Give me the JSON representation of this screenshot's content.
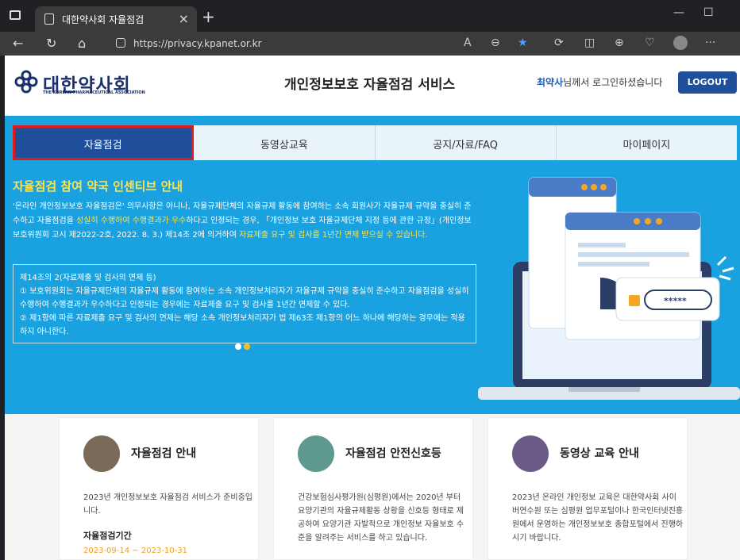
{
  "browser": {
    "tab_title": "대한약사회 자율점검",
    "url": "https://privacy.kpanet.or.kr",
    "close": "×",
    "plus": "+"
  },
  "header": {
    "logo_kr": "대한약사회",
    "logo_en": "THE KOREAN PHARMACEUTICAL ASSOCIATION",
    "service": "개인정보보호 자율점검 서비스",
    "user_name": "최약사",
    "user_suffix": "님께서 로그인하셨습니다",
    "logout": "LOGOUT"
  },
  "menu": [
    "자율점검",
    "동영상교육",
    "공지/자료/FAQ",
    "마이페이지"
  ],
  "hero": {
    "title": "자율점검 참여 약국 인센티브 안내",
    "p1": "'온라인 개인정보보호 자율점검은' 의무사항은 아니나, 자율규제단체의 자율규제 활동에 참여하는 소속 회원사가 자율규제 규약을 충실히 준수하고 자율점검을 ",
    "p1y": "성실히 수행하여 수행결과가 우수",
    "p2": "하다고 인정되는 경우, 「개인정보 보호 자율규제단체 지정 등에 관한 규정」(개인정보보호위원회 고시 제2022-2호, 2022. 8. 3.) 제14조 2에 의거하여 ",
    "p2y": "자료제출 요구 및 검사를 1년간 면제 받으실 수 있습니다.",
    "box1": "제14조의 2(자료제출 및 검사의 면제 등)",
    "box2": "① 보호위원회는 자율규제단체의 자율규제 활동에 참여하는 소속 개인정보처리자가 자율규제 규약을 충실히 준수하고 자율점검을 성실히 수행하여 수행결과가 우수하다고 인정되는 경우에는 자료제출 요구 및 검사를 1년간 면제할 수 있다.",
    "box3": "② 제1항에 따른 자료제출 요구 및 검사의 면제는 해당 소속 개인정보처리자가 법 제63조 제1항의 어느 하나에 해당하는 경우에는 적용하지 아니한다.",
    "password": "*****"
  },
  "cards": [
    {
      "title": "자율점검 안내",
      "text": "2023년 개인정보보호 자율점검 서비스가 준비중입니다.",
      "sub": "자율점검기간",
      "date": "2023-09-14 ~ 2023-10-31"
    },
    {
      "title": "자율점검 안전신호등",
      "text": "건강보험심사평가원(심평원)에서는 2020년 부터 요양기관의 자율규제활동 상황을 신호등 형태로 제공하여 요양기관 자발적으로 개인정보 자율보호 수준을 알려주는 서비스를 하고 있습니다."
    },
    {
      "title": "동영상 교육 안내",
      "text": "2023년 온라인 개인정보 교육은 대한약사회 사이버연수원 또는 심평원 업무포털이나 한국인터넷진흥원에서 운영하는 개인정보보호 종합포털에서 진행하시기 바랍니다."
    }
  ]
}
